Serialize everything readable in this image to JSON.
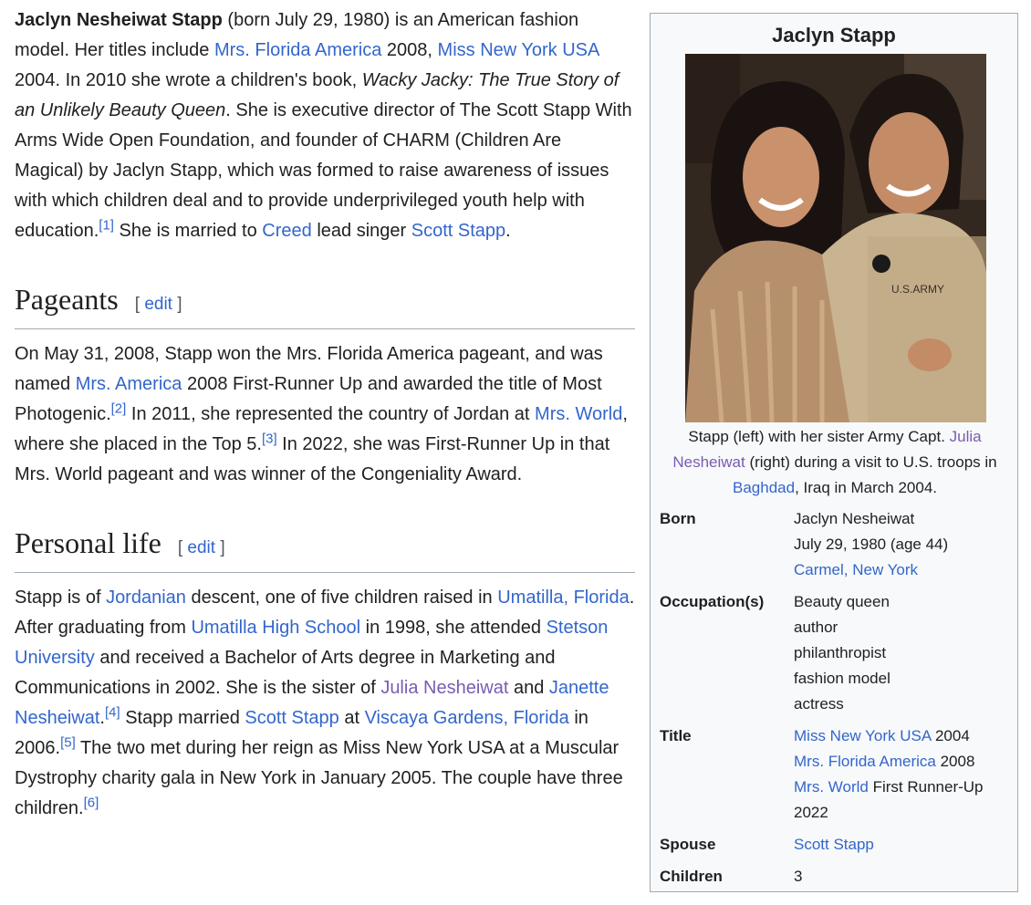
{
  "intro": {
    "p1": "Jaclyn Nesheiwat Stapp",
    "p2": " (born July 29, 1980) is an American fashion model. Her titles include ",
    "l1": "Mrs. Florida America",
    "p3": " 2008, ",
    "l2": "Miss New York USA",
    "p4": " 2004. In 2010 she wrote a children's book, ",
    "book": "Wacky Jacky: The True Story of an Unlikely Beauty Queen",
    "p5": ". She is executive director of The Scott Stapp With Arms Wide Open Foundation, and founder of CHARM (Children Are Magical) by Jaclyn Stapp, which was formed to raise awareness of issues with which children deal and to provide underprivileged youth help with education.",
    "ref1": "[1]",
    "p6": " She is married to ",
    "l3": "Creed",
    "p7": " lead singer ",
    "l4": "Scott Stapp",
    "p8": "."
  },
  "pageants": {
    "heading": "Pageants",
    "edit_open": "[",
    "edit_label": "edit",
    "edit_close": "]",
    "p1": "On May 31, 2008, Stapp won the Mrs. Florida America pageant, and was named ",
    "l1": "Mrs. America",
    "p2": " 2008 First-Runner Up and awarded the title of Most Photogenic.",
    "ref2": "[2]",
    "p3": " In 2011, she represented the country of Jordan at ",
    "l2": "Mrs. World",
    "p4": ", where she placed in the Top 5.",
    "ref3": "[3]",
    "p5": " In 2022, she was First-Runner Up in that Mrs. World pageant and was winner of the Congeniality Award."
  },
  "personal": {
    "heading": "Personal life",
    "edit_open": "[",
    "edit_label": "edit",
    "edit_close": "]",
    "p1": "Stapp is of ",
    "l1": "Jordanian",
    "p2": " descent, one of five children raised in ",
    "l2": "Umatilla, Florida",
    "p3": ". After graduating from ",
    "l3": "Umatilla High School",
    "p4": " in 1998, she attended ",
    "l4": "Stetson University",
    "p5": " and received a Bachelor of Arts degree in Marketing and Communications in 2002. She is the sister of ",
    "l5": "Julia Nesheiwat",
    "p6": " and ",
    "l6": "Janette Nesheiwat",
    "p7": ".",
    "ref4": "[4]",
    "p8": " Stapp married ",
    "l7": "Scott Stapp",
    "p9": " at ",
    "l8": "Viscaya Gardens, Florida",
    "p10": " in 2006.",
    "ref5": "[5]",
    "p11": " The two met during her reign as Miss New York USA at a Muscular Dystrophy charity gala in New York in January 2005. The couple have three children.",
    "ref6": "[6]"
  },
  "infobox": {
    "title": "Jaclyn Stapp",
    "photo_label": "U.S.ARMY",
    "caption_a": "Stapp (left) with her sister Army Capt. ",
    "caption_l1": "Julia Nesheiwat",
    "caption_b": " (right) during a visit to U.S. troops in ",
    "caption_l2": "Baghdad",
    "caption_c": ", Iraq in March 2004.",
    "born_label": "Born",
    "born_name": "Jaclyn Nesheiwat",
    "born_date": "July 29, 1980 (age 44)",
    "born_place": "Carmel, New York",
    "occupation_label": "Occupation(s)",
    "occupations": [
      "Beauty queen",
      "author",
      "philanthropist",
      "fashion model",
      "actress"
    ],
    "title_label": "Title",
    "title_l1": "Miss New York USA",
    "title_t1": " 2004",
    "title_l2": "Mrs. Florida America",
    "title_t2": " 2008",
    "title_l3": "Mrs. World",
    "title_t3": " First Runner-Up",
    "title_t4": "2022",
    "spouse_label": "Spouse",
    "spouse": "Scott Stapp",
    "children_label": "Children",
    "children": "3"
  }
}
